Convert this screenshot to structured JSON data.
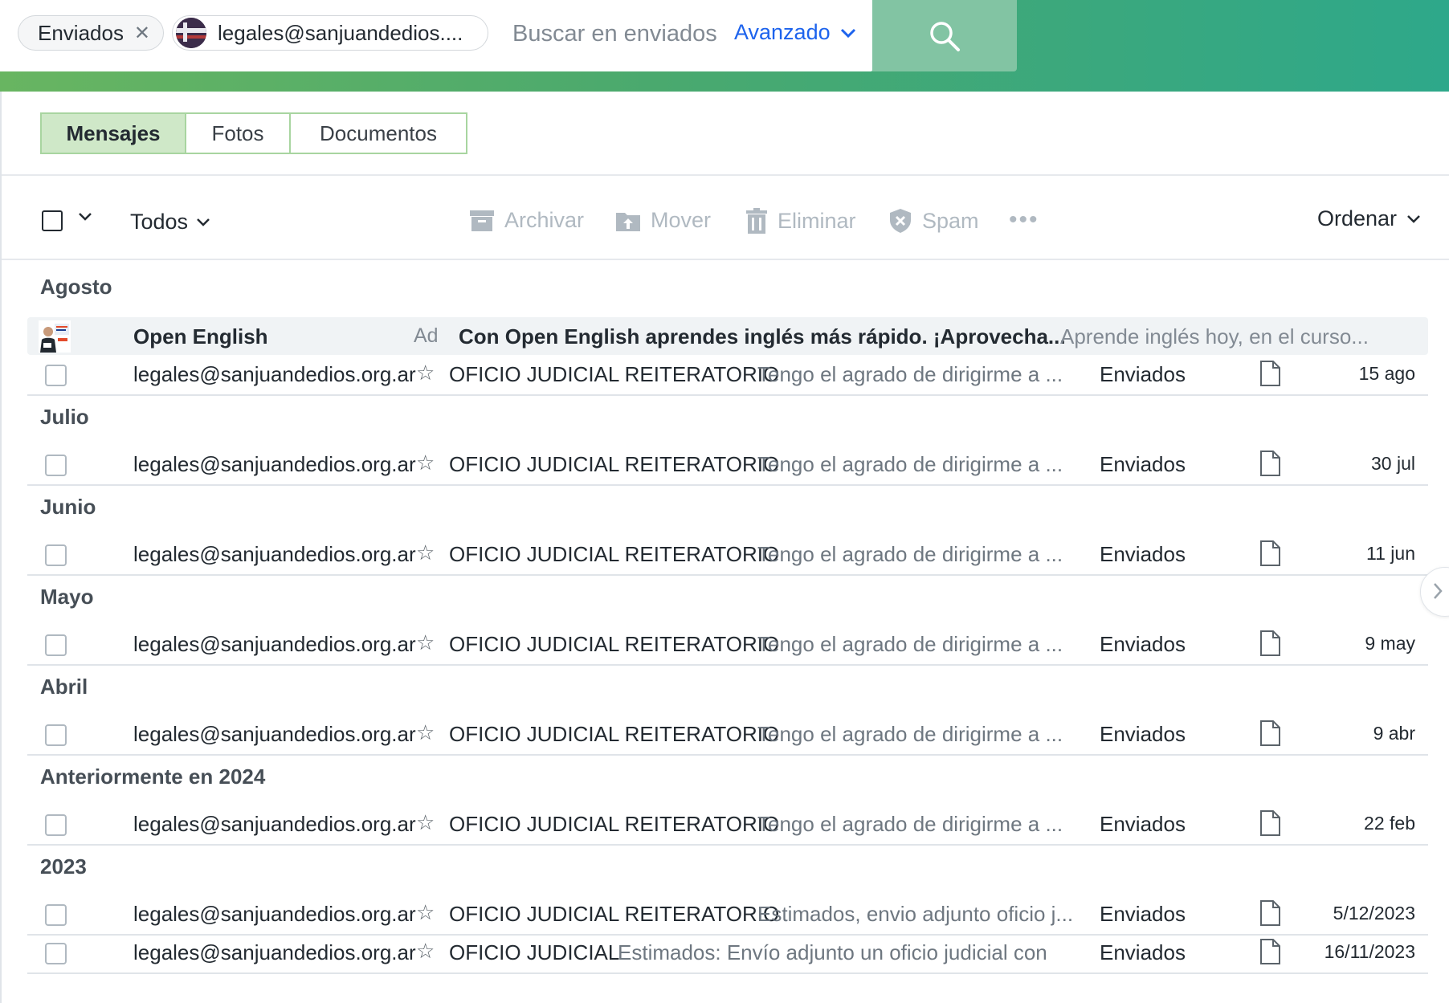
{
  "search": {
    "folder_pill": "Enviados",
    "contact_pill": "legales@sanjuandedios....",
    "placeholder": "Buscar en enviados",
    "advanced_label": "Avanzado"
  },
  "tabs": [
    {
      "label": "Mensajes",
      "active": true
    },
    {
      "label": "Fotos",
      "active": false
    },
    {
      "label": "Documentos",
      "active": false
    }
  ],
  "toolbar": {
    "filter_label": "Todos",
    "archive_label": "Archivar",
    "move_label": "Mover",
    "delete_label": "Eliminar",
    "spam_label": "Spam",
    "more_label": "•••",
    "sort_label": "Ordenar"
  },
  "ad": {
    "sender": "Open English",
    "label": "Ad",
    "subject": "Con Open English aprendes inglés más rápido. ¡Aprovecha...",
    "snippet": "Aprende inglés hoy, en el curso..."
  },
  "sections": [
    {
      "title": "Agosto"
    },
    {
      "title": "Julio"
    },
    {
      "title": "Junio"
    },
    {
      "title": "Mayo"
    },
    {
      "title": "Abril"
    },
    {
      "title": "Anteriormente en 2024"
    },
    {
      "title": "2023"
    }
  ],
  "messages": [
    {
      "sender": "legales@sanjuandedios.org.ar",
      "subject": "OFICIO JUDICIAL REITERATORIO",
      "snippet": "Tengo el agrado de dirigirme a ...",
      "folder": "Enviados",
      "date": "15 ago"
    },
    {
      "sender": "legales@sanjuandedios.org.ar",
      "subject": "OFICIO JUDICIAL REITERATORIO",
      "snippet": "Tengo el agrado de dirigirme a ...",
      "folder": "Enviados",
      "date": "30 jul"
    },
    {
      "sender": "legales@sanjuandedios.org.ar",
      "subject": "OFICIO JUDICIAL REITERATORIO",
      "snippet": "Tengo el agrado de dirigirme a ...",
      "folder": "Enviados",
      "date": "11 jun"
    },
    {
      "sender": "legales@sanjuandedios.org.ar",
      "subject": "OFICIO JUDICIAL REITERATORIO",
      "snippet": "Tengo el agrado de dirigirme a ...",
      "folder": "Enviados",
      "date": "9 may"
    },
    {
      "sender": "legales@sanjuandedios.org.ar",
      "subject": "OFICIO JUDICIAL REITERATORIO",
      "snippet": "Tengo el agrado de dirigirme a ...",
      "folder": "Enviados",
      "date": "9 abr"
    },
    {
      "sender": "legales@sanjuandedios.org.ar",
      "subject": "OFICIO JUDICIAL REITERATORIO",
      "snippet": "Tengo el agrado de dirigirme a ...",
      "folder": "Enviados",
      "date": "22 feb"
    },
    {
      "sender": "legales@sanjuandedios.org.ar",
      "subject": "OFICIO JUDICIAL REITERATORIO",
      "snippet": "Estimados, envio adjunto oficio j...",
      "folder": "Enviados",
      "date": "5/12/2023"
    },
    {
      "sender": "legales@sanjuandedios.org.ar",
      "subject": "OFICIO JUDICIAL",
      "snippet": "Estimados: Envío adjunto un oficio judicial con",
      "folder": "Enviados",
      "date": "16/11/2023"
    }
  ],
  "colors": {
    "header_gradient_start": "#68b561",
    "header_gradient_end": "#2ea88a",
    "search_button": "#82c4a3",
    "accent_link": "#1d63ed",
    "active_tab_bg": "#cfe8c8"
  }
}
